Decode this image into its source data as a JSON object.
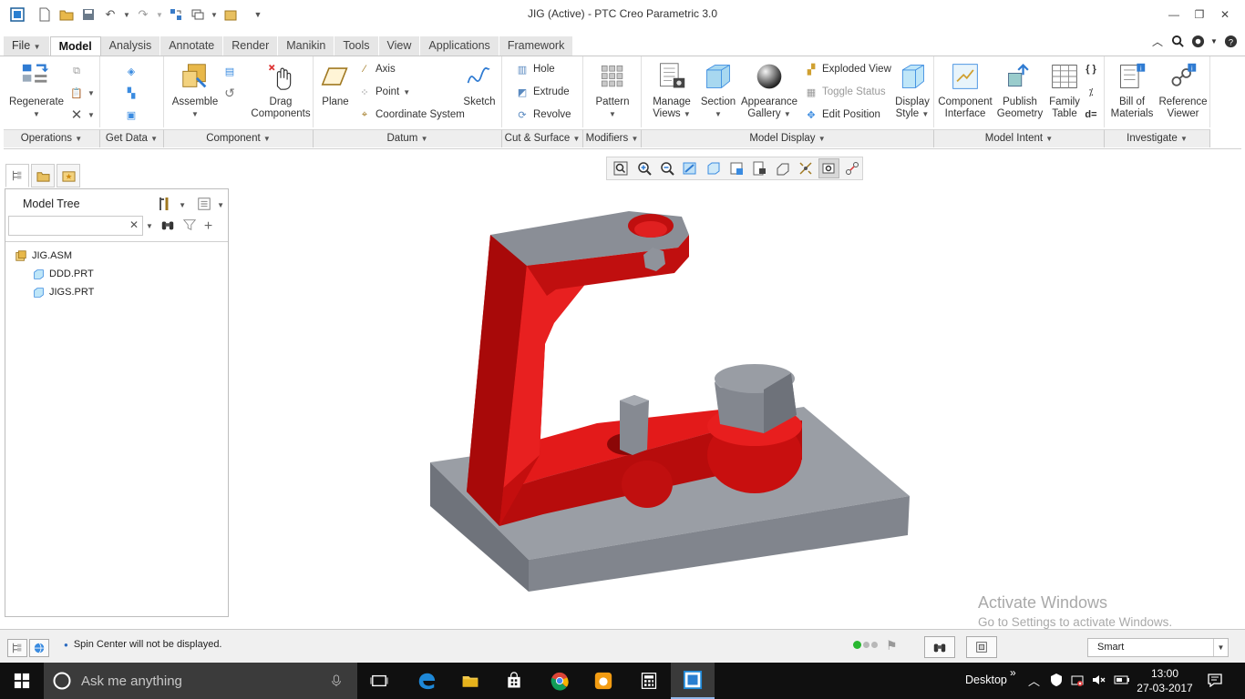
{
  "window": {
    "title": "JIG (Active) - PTC Creo Parametric 3.0"
  },
  "menu_tabs": [
    "File",
    "Model",
    "Analysis",
    "Annotate",
    "Render",
    "Manikin",
    "Tools",
    "View",
    "Applications",
    "Framework"
  ],
  "active_tab": "Model",
  "ribbon": {
    "regenerate": "Regenerate",
    "assemble": "Assemble",
    "drag_1": "Drag",
    "drag_2": "Components",
    "plane": "Plane",
    "axis": "Axis",
    "point": "Point",
    "coord_sys": "Coordinate System",
    "sketch": "Sketch",
    "hole": "Hole",
    "extrude": "Extrude",
    "revolve": "Revolve",
    "pattern": "Pattern",
    "manage_1": "Manage",
    "manage_2": "Views",
    "section": "Section",
    "appearance_1": "Appearance",
    "appearance_2": "Gallery",
    "exploded_view": "Exploded View",
    "toggle_status": "Toggle Status",
    "edit_position": "Edit Position",
    "display_1": "Display",
    "display_2": "Style",
    "comp_iface_1": "Component",
    "comp_iface_2": "Interface",
    "publish_1": "Publish",
    "publish_2": "Geometry",
    "family_1": "Family",
    "family_2": "Table",
    "bom_1": "Bill of",
    "bom_2": "Materials",
    "refview_1": "Reference",
    "refview_2": "Viewer"
  },
  "ribbon_groups": {
    "operations": "Operations",
    "get_data": "Get Data",
    "component": "Component",
    "datum": "Datum",
    "cut_surface": "Cut & Surface",
    "modifiers": "Modifiers",
    "model_display": "Model Display",
    "model_intent": "Model Intent",
    "investigate": "Investigate"
  },
  "model_tree": {
    "title": "Model Tree",
    "search_placeholder": "",
    "items": [
      {
        "label": "JIG.ASM"
      },
      {
        "label": "DDD.PRT"
      },
      {
        "label": "JIGS.PRT"
      }
    ]
  },
  "status": {
    "message": "Spin Center will not be displayed.",
    "filter": "Smart"
  },
  "watermark": {
    "line1": "Activate Windows",
    "line2": "Go to Settings to activate Windows."
  },
  "taskbar": {
    "search_text": "Ask me anything",
    "desktop_label": "Desktop",
    "time": "13:00",
    "date": "27-03-2017"
  },
  "colors": {
    "part_red": "#dd1010",
    "base_gray": "#8a8e96",
    "taskbar": "#101010",
    "accent_blue": "#1e88d8"
  }
}
